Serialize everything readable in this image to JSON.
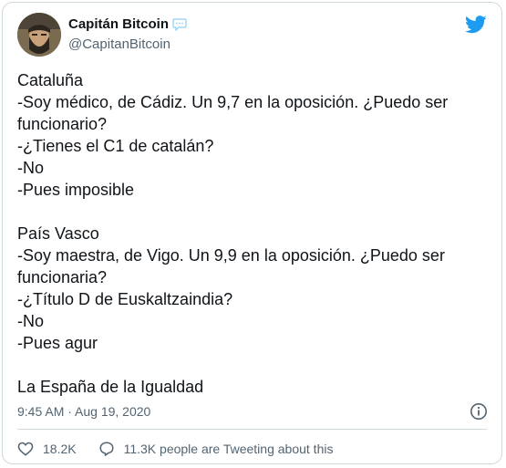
{
  "author": {
    "name": "Capitán Bitcoin",
    "handle": "@CapitanBitcoin"
  },
  "tweet": {
    "lines": [
      "Cataluña",
      "-Soy médico, de Cádiz. Un 9,7 en la oposición. ¿Puedo ser",
      "funcionario?",
      "-¿Tienes el C1 de catalán?",
      "-No",
      "-Pues imposible",
      "",
      "País Vasco",
      "-Soy maestra, de Vigo. Un 9,9 en la oposición. ¿Puedo ser",
      "funcionaria?",
      "-¿Título D de Euskaltzaindia?",
      "-No",
      "-Pues agur",
      "",
      "La España de la Igualdad"
    ],
    "timestamp": "9:45 AM · Aug 19, 2020"
  },
  "actions": {
    "likes": "18.2K",
    "retweet_text": "11.3K people are Tweeting about this"
  },
  "colors": {
    "twitter_blue": "#1d9bf0",
    "secondary_text": "#536471"
  },
  "icons": [
    "chat-bubble-icon",
    "twitter-bird-icon",
    "info-icon",
    "heart-icon",
    "comment-icon"
  ]
}
